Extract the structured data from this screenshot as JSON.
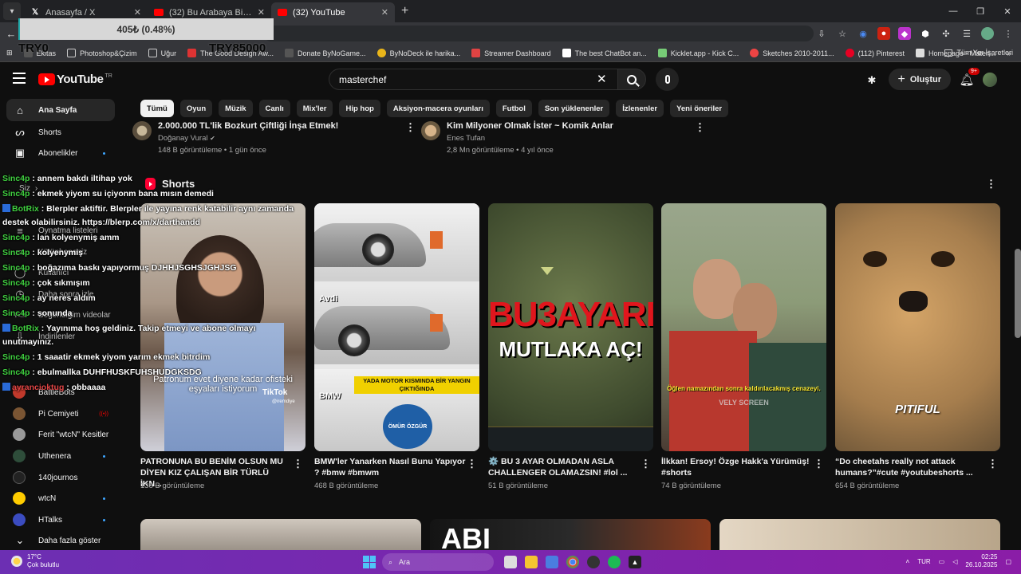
{
  "browser": {
    "tabs": [
      {
        "title": "Anasayfa / X",
        "favicon": "x-icon"
      },
      {
        "title": "(32) Bu Arabaya Bindiğinizde M",
        "favicon": "youtube-icon"
      },
      {
        "title": "(32) YouTube",
        "favicon": "youtube-icon",
        "active": true
      }
    ],
    "new_tab": "+",
    "bookmarks": [
      "Ekitas",
      "Photoshop&Çizim",
      "Uğur",
      "The Good Design Aw...",
      "Donate ByNoGame...",
      "ByNoDeck ile harika...",
      "Streamer Dashboard",
      "The best ChatBot an...",
      "Kicklet.app - Kick C...",
      "Sketches 2010-2011...",
      "(112) Pinterest",
      "Homepage - Materi..."
    ],
    "bookmarks_more": "»",
    "all_bookmarks": "Tüm Yer İşaretleri"
  },
  "overlay": {
    "donation_text": "405₺ (0.48%)",
    "left_amount": "TRY0",
    "right_amount": "TRY85000"
  },
  "youtube": {
    "logo_text": "YouTube",
    "logo_region": "TR",
    "search_value": "masterchef",
    "create_label": "Oluştur",
    "notif_count": "9+",
    "chips": [
      "Tümü",
      "Oyun",
      "Müzik",
      "Canlı",
      "Mix'ler",
      "Hip hop",
      "Aksiyon-macera oyunları",
      "Futbol",
      "Son yüklenenler",
      "İzlenenler",
      "Yeni öneriler"
    ],
    "sidebar": {
      "items": [
        {
          "label": "Ana Sayfa",
          "icon": "home-icon"
        },
        {
          "label": "Shorts",
          "icon": "shorts-icon"
        },
        {
          "label": "Abonelikler",
          "icon": "subscriptions-icon"
        },
        {
          "label": "Siz",
          "icon": "chevron-right-icon"
        },
        {
          "label": "Oynatma listeleri",
          "icon": "playlist-icon"
        },
        {
          "label": "Kütüphaneniz",
          "icon": "library-icon"
        },
        {
          "label": "Kullanıcı",
          "icon": "user-icon"
        },
        {
          "label": "Daha sonra izle",
          "icon": "clock-icon"
        },
        {
          "label": "Beğendiğim videolar",
          "icon": "like-icon"
        },
        {
          "label": "İndirilenler",
          "icon": "download-icon"
        }
      ],
      "channels": [
        {
          "name": "BattleBots",
          "color": "#c0392b"
        },
        {
          "name": "Pi Cemiyeti",
          "color": "#7a5533"
        },
        {
          "name": "Ferit \"wtcN\" Kesitler",
          "color": "#999999"
        },
        {
          "name": "Uthenera",
          "color": "#2e4d3a"
        },
        {
          "name": "140journos",
          "color": "#222222"
        },
        {
          "name": "wtcN",
          "color": "#ffcc00"
        },
        {
          "name": "HTalks",
          "color": "#3b4cc0"
        }
      ],
      "show_more": "Daha fazla göster"
    },
    "top_videos": [
      {
        "title": "2.000.000 TL'lik Bozkurt Çiftliği İnşa Etmek!",
        "channel": "Doğanay Vural",
        "verified": "✔",
        "meta": "148 B görüntüleme • 1 gün önce"
      },
      {
        "title": "Kim Milyoner Olmak İster ~ Komik Anlar",
        "channel": "Enes Tufan",
        "meta": "2,8 Mn görüntüleme • 4 yıl önce"
      }
    ],
    "shorts_header": "Shorts",
    "shorts": [
      {
        "title": "PATRONUNA BU BENİM OLSUN MU DİYEN KIZ ÇALIŞAN BİR TÜRLÜ İKN...",
        "views": "138 B görüntüleme",
        "overlay": "Patronum evet diyene kadar ofisteki eşyaları istiyorum",
        "tiktok": "TikTok",
        "tiktok_user": "@iremdiye"
      },
      {
        "title": "BMW'ler Yanarken Nasıl Bunu Yapıyor ? #bmw #bmwm",
        "views": "468 B görüntüleme",
        "overlay": "YADA MOTOR KISMINDA BİR YANGIN ÇIKTIĞINDA",
        "label_a": "Avdi",
        "label_b": "BMW",
        "brand": "ÖMÜR ÖZGÜR"
      },
      {
        "title": "⚙️ BU 3 AYAR OLMADAN ASLA CHALLENGER OLAMAZSIN! #lol ...",
        "views": "51 B görüntüleme",
        "line1": "BU3AYARI",
        "line2": "MUTLAKA AÇ!"
      },
      {
        "title": "İlkkan! Ersoy! Özge Hakk'a Yürümüş! #shorts",
        "views": "74 B görüntüleme",
        "overlay": "Öğlen namazından sonra kaldırılacakmış cenazeyi.",
        "watermark": "VELY SCREEN"
      },
      {
        "title": "“Do cheetahs really not attack humans?”#cute #youtubeshorts ...",
        "views": "654 B görüntüleme",
        "overlay": "PITIFUL"
      }
    ],
    "bottom_thumb_text": "ABI"
  },
  "chat": [
    {
      "user": "Sinc4p",
      "msg": ": annem bakdı iltihap yok"
    },
    {
      "user": "Sinc4p",
      "msg": ": ekmek yiyom su içiyonm bana mısın demedi"
    },
    {
      "user": "BotRix",
      "msg": ": Blerpler aktiftir. Blerpler ile yayına renk katabilir aynı zamanda",
      "bot": true
    },
    {
      "user": "",
      "msg": "destek olabilirsiniz. https://blerp.com/x/darthandd"
    },
    {
      "user": "Sinc4p",
      "msg": ": lan kolyenymiş amm"
    },
    {
      "user": "Sinc4p",
      "msg": ": kolyenymiş"
    },
    {
      "user": "Sinc4p",
      "msg": ": boğazıma baskı yapıyormuş DJHHJSGHSJGHJSG"
    },
    {
      "user": "Sinc4p",
      "msg": ": çok sıkmışım"
    },
    {
      "user": "Sinc4p",
      "msg": ": ay neres aldım"
    },
    {
      "user": "Sinc4p",
      "msg": ": sonunda"
    },
    {
      "user": "BotRix",
      "msg": ": Yayınıma hoş geldiniz. Takip etmeyi ve abone olmayı",
      "bot": true
    },
    {
      "user": "",
      "msg": "unutmayınız."
    },
    {
      "user": "Sinc4p",
      "msg": ": 1 saaatir ekmek yiyom yarım ekmek bitrdim"
    },
    {
      "user": "Sinc4p",
      "msg": ": ebulmallka DUHFHUSKFUHSHUDGKSDG"
    },
    {
      "user": "ayrancioktug",
      "msg": ": obbaaaa",
      "red": true
    }
  ],
  "taskbar": {
    "temp": "17°C",
    "weather": "Çok bulutlu",
    "search": "Ara",
    "time": "02:25",
    "date": "26.10.2025",
    "lang": "TUR"
  },
  "colors": {
    "accent": "#ff0000",
    "taskbar": "#7b1fa2",
    "chat_user": "#40d040"
  }
}
